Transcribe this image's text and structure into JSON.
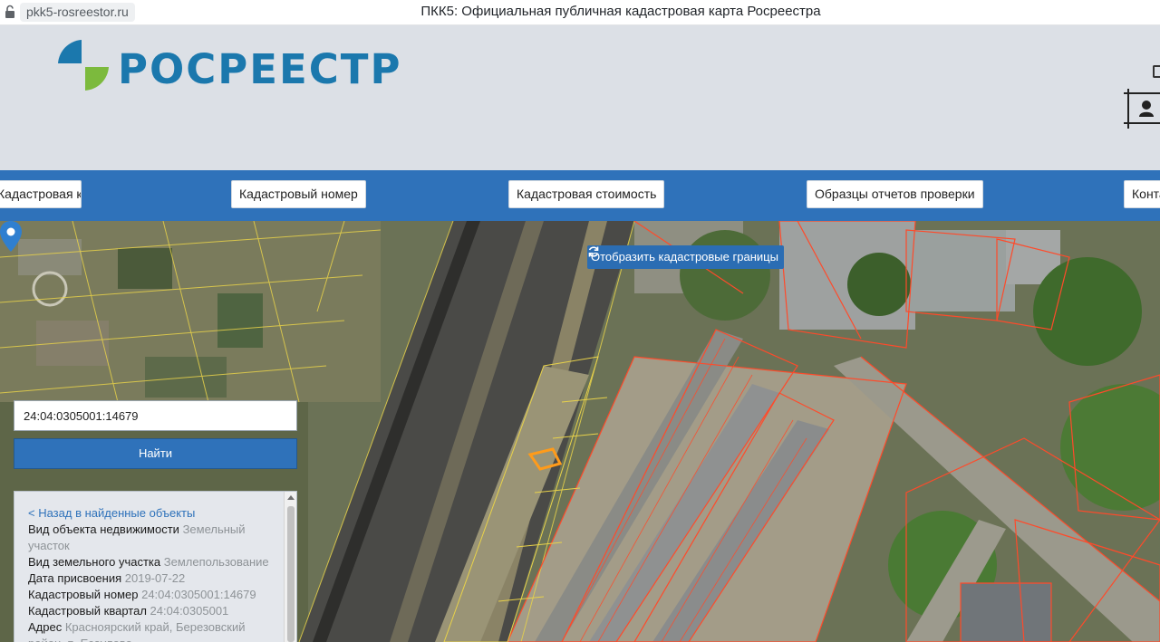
{
  "browser": {
    "url": "pkk5-rosreestor.ru",
    "title": "ПКК5: Официальная публичная кадастровая карта Росреестра"
  },
  "header": {
    "logo_text": "РОСРЕЕСТР"
  },
  "nav": {
    "items": [
      {
        "label": "Кадастровая карта"
      },
      {
        "label": "Кадастровый номер"
      },
      {
        "label": "Кадастровая стоимость"
      },
      {
        "label": "Образцы отчетов проверки"
      },
      {
        "label": "Контакты"
      }
    ]
  },
  "map": {
    "toggle_borders_label": "Отобразить кадастровые границы",
    "search": {
      "value": "24:04:0305001:14679",
      "button_label": "Найти"
    },
    "info": {
      "back_label": "< Назад в найденные объекты",
      "rows": [
        {
          "label": "Вид объекта недвижимости",
          "value": "Земельный участок"
        },
        {
          "label": "Вид земельного участка",
          "value": "Землепользование"
        },
        {
          "label": "Дата присвоения",
          "value": "2019-07-22"
        },
        {
          "label": "Кадастровый номер",
          "value": "24:04:0305001:14679"
        },
        {
          "label": "Кадастровый квартал",
          "value": "24:04:0305001"
        },
        {
          "label": "Адрес",
          "value": "Красноярский край, Березовский район, п. Есаулово"
        }
      ]
    }
  },
  "colors": {
    "brand_blue": "#2f72ba",
    "logo_blue": "#1b78ad",
    "logo_green": "#7cba3d",
    "cadastral_red": "#ff4a2a",
    "cadastral_yellow": "#e8d24a",
    "selected_parcel": "#ff9b1a"
  }
}
